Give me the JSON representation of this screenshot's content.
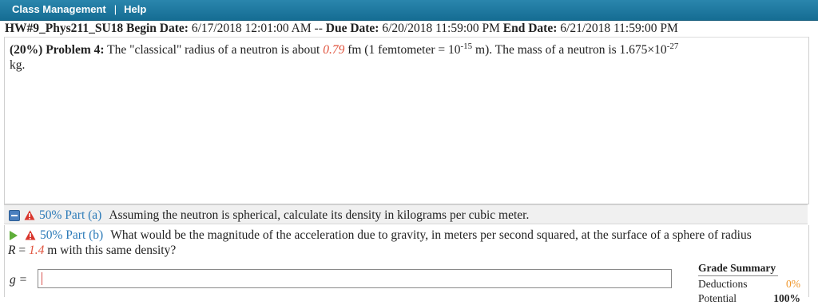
{
  "menu": {
    "class_management": "Class Management",
    "separator": "|",
    "help": "Help"
  },
  "hw": {
    "title": "HW#9_Phys211_SU18",
    "begin_label": "Begin Date:",
    "begin_value": "6/17/2018 12:01:00 AM",
    "dash": "--",
    "due_label": "Due Date:",
    "due_value": "6/20/2018 11:59:00 PM",
    "end_label": "End Date:",
    "end_value": "6/21/2018 11:59:00 PM"
  },
  "problem": {
    "weight": "(20%)",
    "label": "Problem 4:",
    "text1": "The \"classical\" radius of a neutron is about",
    "radius": "0.79",
    "text2": "fm (1 femtometer = 10",
    "exp1": "-15",
    "text3": "m). The mass of a neutron is 1.675×10",
    "exp2": "-27",
    "text4": "kg."
  },
  "part_a": {
    "pct": "50% Part (a)",
    "text": "Assuming the neutron is spherical, calculate its density in kilograms per cubic meter."
  },
  "part_b": {
    "pct": "50% Part (b)",
    "text1": "What would be the magnitude of the acceleration due to gravity, in meters per second squared, at the surface of a sphere of radius",
    "r_label": "R",
    "eq": "=",
    "r_value": "1.4",
    "text2": "m with this same density?"
  },
  "answer": {
    "label": "g =",
    "value": ""
  },
  "grade_summary": {
    "title": "Grade Summary",
    "deductions_label": "Deductions",
    "deductions_value": "0%",
    "potential_label": "Potential",
    "potential_value": "100%"
  },
  "colors": {
    "accent_blue": "#1a7aa3",
    "red_value": "#e0523c",
    "orange": "#f0962a"
  }
}
